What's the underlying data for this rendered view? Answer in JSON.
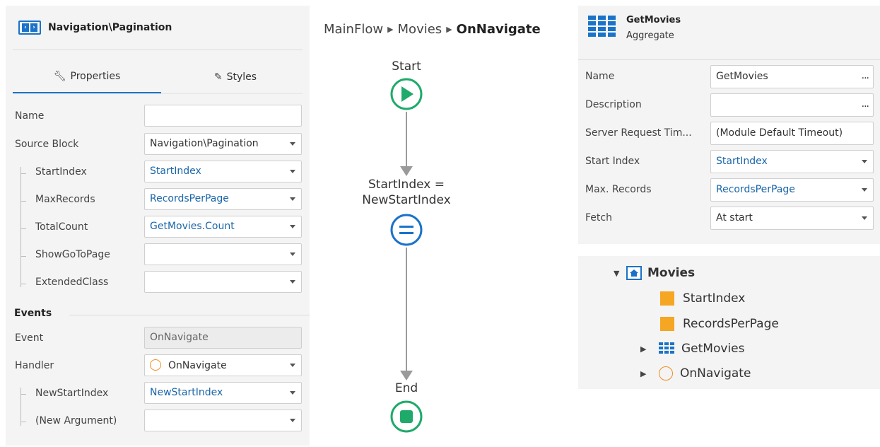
{
  "left_panel": {
    "title": "Navigation\\Pagination",
    "tabs": [
      {
        "label": "Properties",
        "icon": "wrench-icon"
      },
      {
        "label": "Styles",
        "icon": "brush-icon"
      }
    ],
    "rows": [
      {
        "label": "Name",
        "value": ""
      },
      {
        "label": "Source Block",
        "value": "Navigation\\Pagination"
      },
      {
        "label": "StartIndex",
        "value": "StartIndex"
      },
      {
        "label": "MaxRecords",
        "value": "RecordsPerPage"
      },
      {
        "label": "TotalCount",
        "value": "GetMovies.Count"
      },
      {
        "label": "ShowGoToPage",
        "value": ""
      },
      {
        "label": "ExtendedClass",
        "value": ""
      }
    ],
    "events_heading": "Events",
    "event_rows": [
      {
        "label": "Event",
        "value": "OnNavigate"
      },
      {
        "label": "Handler",
        "value": "OnNavigate"
      },
      {
        "label": "NewStartIndex",
        "value": "NewStartIndex"
      },
      {
        "label": "(New Argument)",
        "value": ""
      }
    ]
  },
  "breadcrumb": {
    "items": [
      "MainFlow",
      "Movies",
      "OnNavigate"
    ],
    "separator": "▶"
  },
  "flow": {
    "start_label": "Start",
    "assign_label_line1": "StartIndex =",
    "assign_label_line2": "NewStartIndex",
    "end_label": "End",
    "colors": {
      "start": "#1faa6b",
      "assign": "#1a73c9",
      "end": "#1faa6b",
      "connector": "#9a9a9a"
    }
  },
  "right_panel": {
    "title": "GetMovies",
    "subtitle": "Aggregate",
    "rows": [
      {
        "label": "Name",
        "value": "GetMovies"
      },
      {
        "label": "Description",
        "value": ""
      },
      {
        "label": "Server Request Tim...",
        "value": "(Module Default Timeout)"
      },
      {
        "label": "Start Index",
        "value": "StartIndex"
      },
      {
        "label": "Max. Records",
        "value": "RecordsPerPage"
      },
      {
        "label": "Fetch",
        "value": "At start"
      }
    ],
    "ellipsis": "..."
  },
  "tree": {
    "root": "Movies",
    "items": [
      {
        "label": "StartIndex",
        "icon": "variable-icon"
      },
      {
        "label": "RecordsPerPage",
        "icon": "variable-icon"
      },
      {
        "label": "GetMovies",
        "icon": "aggregate-icon"
      },
      {
        "label": "OnNavigate",
        "icon": "action-icon"
      }
    ]
  }
}
